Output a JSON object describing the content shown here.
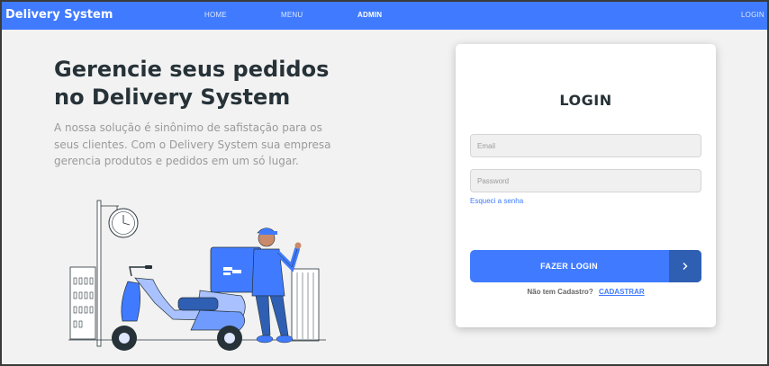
{
  "navbar": {
    "brand": "Delivery System",
    "links": [
      {
        "label": "HOME",
        "active": false
      },
      {
        "label": "MENU",
        "active": false
      },
      {
        "label": "ADMIN",
        "active": true
      }
    ],
    "login": "LOGIN"
  },
  "hero": {
    "title_line1": "Gerencie seus pedidos",
    "title_line2": "no Delivery System",
    "description": "A nossa solução é sinônimo de safistação para os seus clientes. Com o Delivery System sua empresa gerencia produtos e pedidos em um só lugar."
  },
  "login_card": {
    "title": "LOGIN",
    "email_placeholder": "Email",
    "password_placeholder": "Password",
    "forgot_password": "Esqueci a senha",
    "submit_label": "FAZER LOGIN",
    "signup_question": "Não tem Cadastro?",
    "signup_link": "CADASTRAR"
  },
  "colors": {
    "primary": "#407bff",
    "primary_dark": "#2f5fb3",
    "text_dark": "#263238",
    "text_muted": "#9a9a9a",
    "background": "#f2f2f2"
  },
  "icons": {
    "submit_arrow": "chevron-right-icon",
    "illustration": "delivery-courier-scooter-illustration"
  }
}
